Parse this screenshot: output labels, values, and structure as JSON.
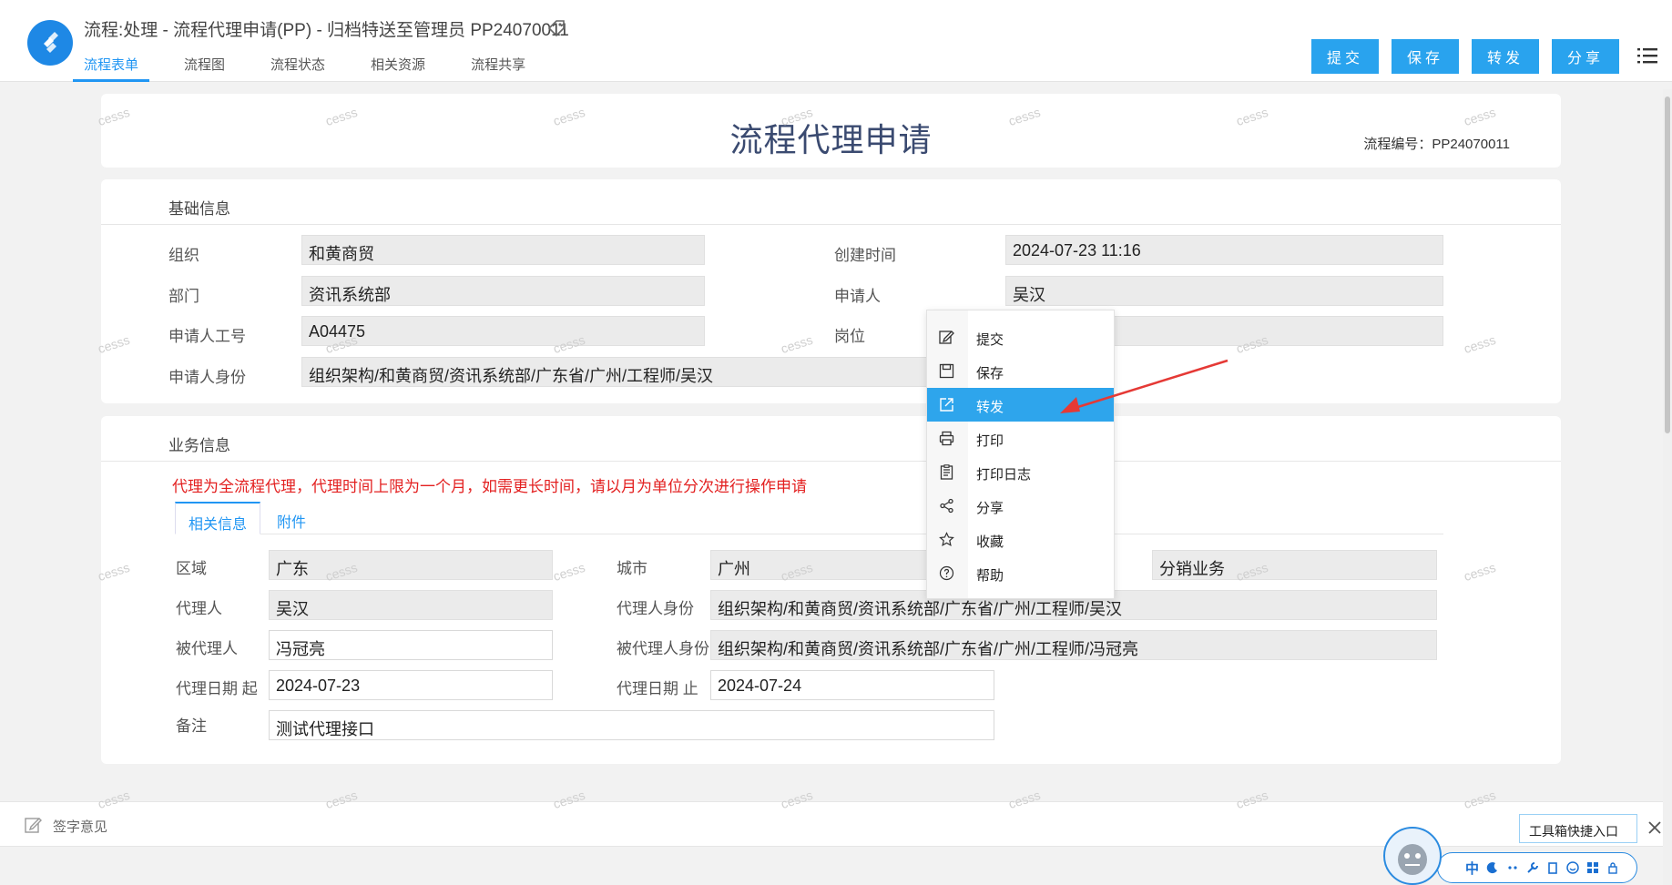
{
  "header": {
    "title": "流程:处理 - 流程代理申请(PP) - 归档特送至管理员 PP24070011",
    "tabs": [
      "流程表单",
      "流程图",
      "流程状态",
      "相关资源",
      "流程共享"
    ],
    "actions": [
      "提交",
      "保存",
      "转发",
      "分享"
    ]
  },
  "form": {
    "title": "流程代理申请",
    "flow_no": "流程编号：PP24070011"
  },
  "basic": {
    "section_title": "基础信息",
    "org_label": "组织",
    "org_value": "和黄商贸",
    "created_label": "创建时间",
    "created_value": "2024-07-23 11:16",
    "dept_label": "部门",
    "dept_value": "资讯系统部",
    "applicant_label": "申请人",
    "applicant_value": "吴汉",
    "empno_label": "申请人工号",
    "empno_value": "A04475",
    "post_label": "岗位",
    "post_value": "",
    "identity_label": "申请人身份",
    "identity_value": "组织架构/和黄商贸/资讯系统部/广东省/广州/工程师/吴汉"
  },
  "biz": {
    "section_title": "业务信息",
    "warning": "代理为全流程代理，代理时间上限为一个月，如需更长时间，请以月为单位分次进行操作申请",
    "subtabs": [
      "相关信息",
      "附件"
    ],
    "region_label": "区域",
    "region_value": "广东",
    "city_label": "城市",
    "city_value": "广州",
    "business_value": "分销业务",
    "agent_label": "代理人",
    "agent_value": "吴汉",
    "agent_identity_label": "代理人身份",
    "agent_identity_value": "组织架构/和黄商贸/资讯系统部/广东省/广州/工程师/吴汉",
    "principal_label": "被代理人",
    "principal_value": "冯冠亮",
    "principal_identity_label": "被代理人身份",
    "principal_identity_value": "组织架构/和黄商贸/资讯系统部/广东省/广州/工程师/冯冠亮",
    "start_label": "代理日期 起",
    "start_value": "2024-07-23",
    "end_label": "代理日期 止",
    "end_value": "2024-07-24",
    "remark_label": "备注",
    "remark_value": "测试代理接口"
  },
  "sign": {
    "label": "签字意见"
  },
  "context_menu": {
    "items": [
      "提交",
      "保存",
      "转发",
      "打印",
      "打印日志",
      "分享",
      "收藏",
      "帮助"
    ],
    "selected": "转发"
  },
  "watermark": "cesss",
  "toolbox": {
    "tip": "工具箱快捷入口",
    "ime_label": "中"
  },
  "colors": {
    "accent": "#2196f3",
    "button": "#29a3ee",
    "warning": "#e32020",
    "arrow": "#e53935"
  }
}
